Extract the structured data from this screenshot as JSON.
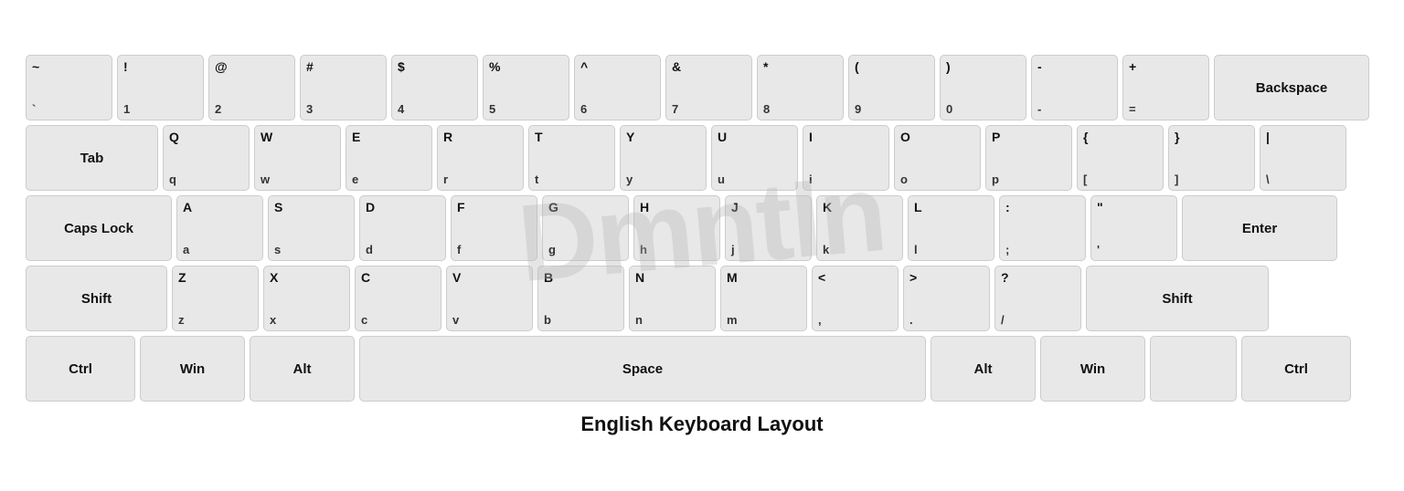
{
  "title": "English Keyboard Layout",
  "watermark": "DmntIn",
  "rows": [
    {
      "keys": [
        {
          "id": "tilde",
          "upper": "~",
          "lower": "`",
          "w": "u1"
        },
        {
          "id": "1",
          "upper": "!",
          "lower": "1",
          "w": "u1"
        },
        {
          "id": "2",
          "upper": "@",
          "lower": "2",
          "w": "u1"
        },
        {
          "id": "3",
          "upper": "#",
          "lower": "3",
          "w": "u1"
        },
        {
          "id": "4",
          "upper": "$",
          "lower": "4",
          "w": "u1"
        },
        {
          "id": "5",
          "upper": "%",
          "lower": "5",
          "w": "u1"
        },
        {
          "id": "6",
          "upper": "^",
          "lower": "6",
          "w": "u1"
        },
        {
          "id": "7",
          "upper": "&",
          "lower": "7",
          "w": "u1"
        },
        {
          "id": "8",
          "upper": "*",
          "lower": "8",
          "w": "u1"
        },
        {
          "id": "9",
          "upper": "(",
          "lower": "9",
          "w": "u1"
        },
        {
          "id": "0",
          "upper": ")",
          "lower": "0",
          "w": "u1"
        },
        {
          "id": "minus",
          "upper": "-",
          "lower": "-",
          "w": "u1"
        },
        {
          "id": "equals",
          "upper": "+",
          "lower": "=",
          "w": "u1"
        },
        {
          "id": "backspace",
          "label": "Backspace",
          "w": "u-backspace"
        }
      ]
    },
    {
      "keys": [
        {
          "id": "tab",
          "label": "Tab",
          "w": "u15"
        },
        {
          "id": "q",
          "upper": "Q",
          "lower": "q",
          "w": "u1"
        },
        {
          "id": "w",
          "upper": "W",
          "lower": "w",
          "w": "u1"
        },
        {
          "id": "e",
          "upper": "E",
          "lower": "e",
          "w": "u1"
        },
        {
          "id": "r",
          "upper": "R",
          "lower": "r",
          "w": "u1"
        },
        {
          "id": "t",
          "upper": "T",
          "lower": "t",
          "w": "u1"
        },
        {
          "id": "y",
          "upper": "Y",
          "lower": "y",
          "w": "u1"
        },
        {
          "id": "u",
          "upper": "U",
          "lower": "u",
          "w": "u1"
        },
        {
          "id": "i",
          "upper": "I",
          "lower": "i",
          "w": "u1"
        },
        {
          "id": "o",
          "upper": "O",
          "lower": "o",
          "w": "u1"
        },
        {
          "id": "p",
          "upper": "P",
          "lower": "p",
          "w": "u1"
        },
        {
          "id": "lbracket",
          "upper": "{",
          "lower": "[",
          "w": "u1"
        },
        {
          "id": "rbracket",
          "upper": "}",
          "lower": "]",
          "w": "u1"
        },
        {
          "id": "backslash",
          "upper": "|",
          "lower": "\\",
          "w": "u1"
        }
      ]
    },
    {
      "keys": [
        {
          "id": "capslock",
          "label": "Caps Lock",
          "w": "u-caps"
        },
        {
          "id": "a",
          "upper": "A",
          "lower": "a",
          "w": "u1"
        },
        {
          "id": "s",
          "upper": "S",
          "lower": "s",
          "w": "u1"
        },
        {
          "id": "d",
          "upper": "D",
          "lower": "d",
          "w": "u1"
        },
        {
          "id": "f",
          "upper": "F",
          "lower": "f",
          "w": "u1"
        },
        {
          "id": "g",
          "upper": "G",
          "lower": "g",
          "w": "u1"
        },
        {
          "id": "h",
          "upper": "H",
          "lower": "h",
          "w": "u1"
        },
        {
          "id": "j",
          "upper": "J",
          "lower": "j",
          "w": "u1"
        },
        {
          "id": "k",
          "upper": "K",
          "lower": "k",
          "w": "u1"
        },
        {
          "id": "l",
          "upper": "L",
          "lower": "l",
          "w": "u1"
        },
        {
          "id": "semicolon",
          "upper": ":",
          "lower": ";",
          "w": "u1"
        },
        {
          "id": "quote",
          "upper": "\"",
          "lower": "'",
          "w": "u1"
        },
        {
          "id": "enter",
          "label": "Enter",
          "w": "u-enter"
        }
      ]
    },
    {
      "keys": [
        {
          "id": "lshift",
          "label": "Shift",
          "w": "u-lshift"
        },
        {
          "id": "z",
          "upper": "Z",
          "lower": "z",
          "w": "u1"
        },
        {
          "id": "x",
          "upper": "X",
          "lower": "x",
          "w": "u1"
        },
        {
          "id": "c",
          "upper": "C",
          "lower": "c",
          "w": "u1"
        },
        {
          "id": "v",
          "upper": "V",
          "lower": "v",
          "w": "u1"
        },
        {
          "id": "b",
          "upper": "B",
          "lower": "b",
          "w": "u1"
        },
        {
          "id": "n",
          "upper": "N",
          "lower": "n",
          "w": "u1"
        },
        {
          "id": "m",
          "upper": "M",
          "lower": "m",
          "w": "u1"
        },
        {
          "id": "comma",
          "upper": "<",
          "lower": ",",
          "w": "u1"
        },
        {
          "id": "period",
          "upper": ">",
          "lower": ".",
          "w": "u1"
        },
        {
          "id": "slash",
          "upper": "?",
          "lower": "/",
          "w": "u1"
        },
        {
          "id": "rshift",
          "label": "Shift",
          "w": "u-rshift"
        }
      ]
    },
    {
      "keys": [
        {
          "id": "lctrl",
          "label": "Ctrl",
          "w": "u-ctrl"
        },
        {
          "id": "lwin",
          "label": "Win",
          "w": "u-win"
        },
        {
          "id": "lalt",
          "label": "Alt",
          "w": "u-alt"
        },
        {
          "id": "space",
          "label": "Space",
          "w": "u-space"
        },
        {
          "id": "ralt",
          "label": "Alt",
          "w": "u-alt"
        },
        {
          "id": "rwin",
          "label": "Win",
          "w": "u-win"
        },
        {
          "id": "menu",
          "label": "",
          "w": "u1"
        },
        {
          "id": "rctrl",
          "label": "Ctrl",
          "w": "u-ctrl"
        }
      ]
    }
  ]
}
